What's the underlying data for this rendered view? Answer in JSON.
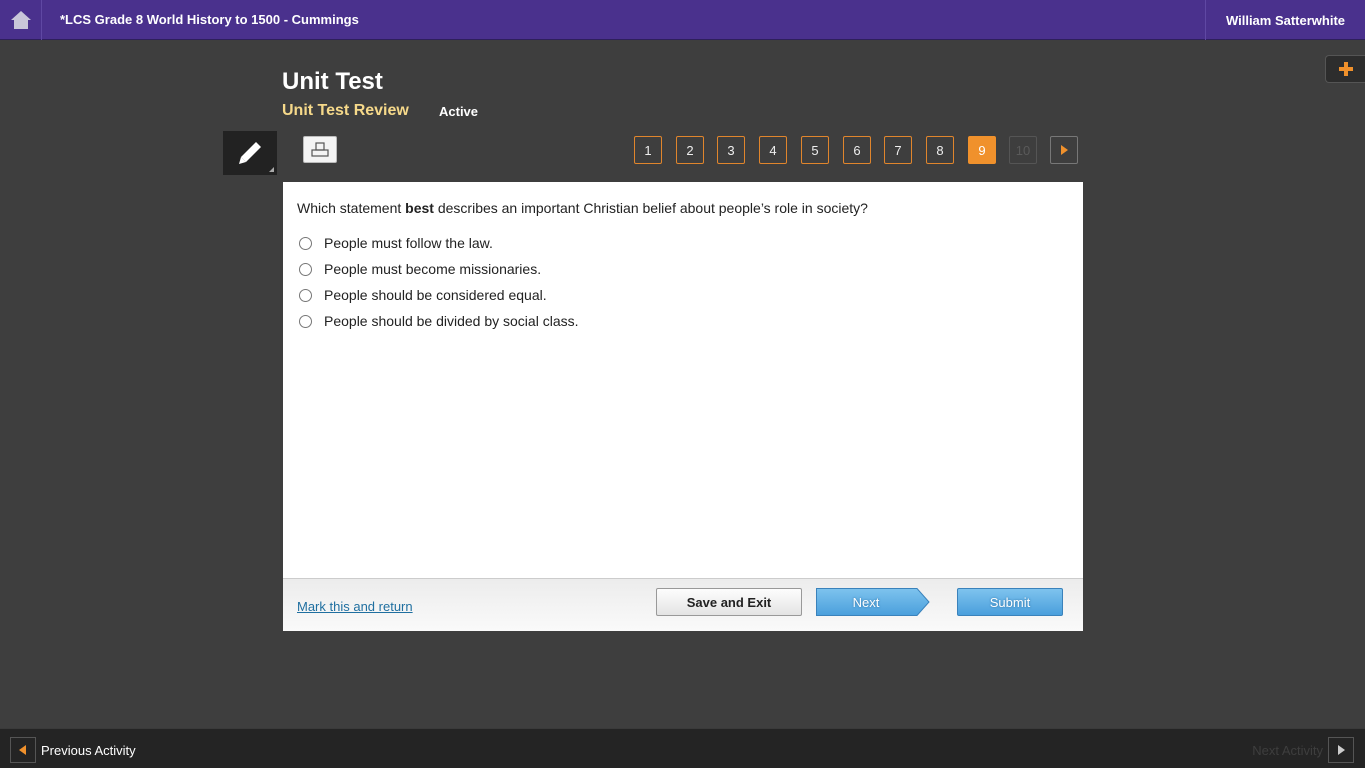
{
  "header": {
    "course_title": "*LCS Grade 8 World History to 1500 - Cummings",
    "user_name": "William Satterwhite"
  },
  "page": {
    "title": "Unit Test",
    "subtitle": "Unit Test Review",
    "status": "Active"
  },
  "question_nav": {
    "items": [
      "1",
      "2",
      "3",
      "4",
      "5",
      "6",
      "7",
      "8",
      "9",
      "10"
    ],
    "current": "9",
    "disabled": "10"
  },
  "question": {
    "prefix": "Which statement ",
    "emphasis": "best",
    "suffix": " describes an important Christian belief about people’s role in society?",
    "options": [
      "People must follow the law.",
      "People must become missionaries.",
      "People should be considered equal.",
      "People should be divided by social class."
    ]
  },
  "footer": {
    "mark_label": "Mark this and return",
    "save_label": "Save and Exit",
    "next_label": "Next",
    "submit_label": "Submit"
  },
  "bottom": {
    "prev_label": "Previous Activity",
    "next_label": "Next Activity"
  },
  "colors": {
    "topbar": "#4a318d",
    "accent": "#f0912c",
    "subtitle": "#f6d98a",
    "button_blue": "#4a9fdc"
  }
}
